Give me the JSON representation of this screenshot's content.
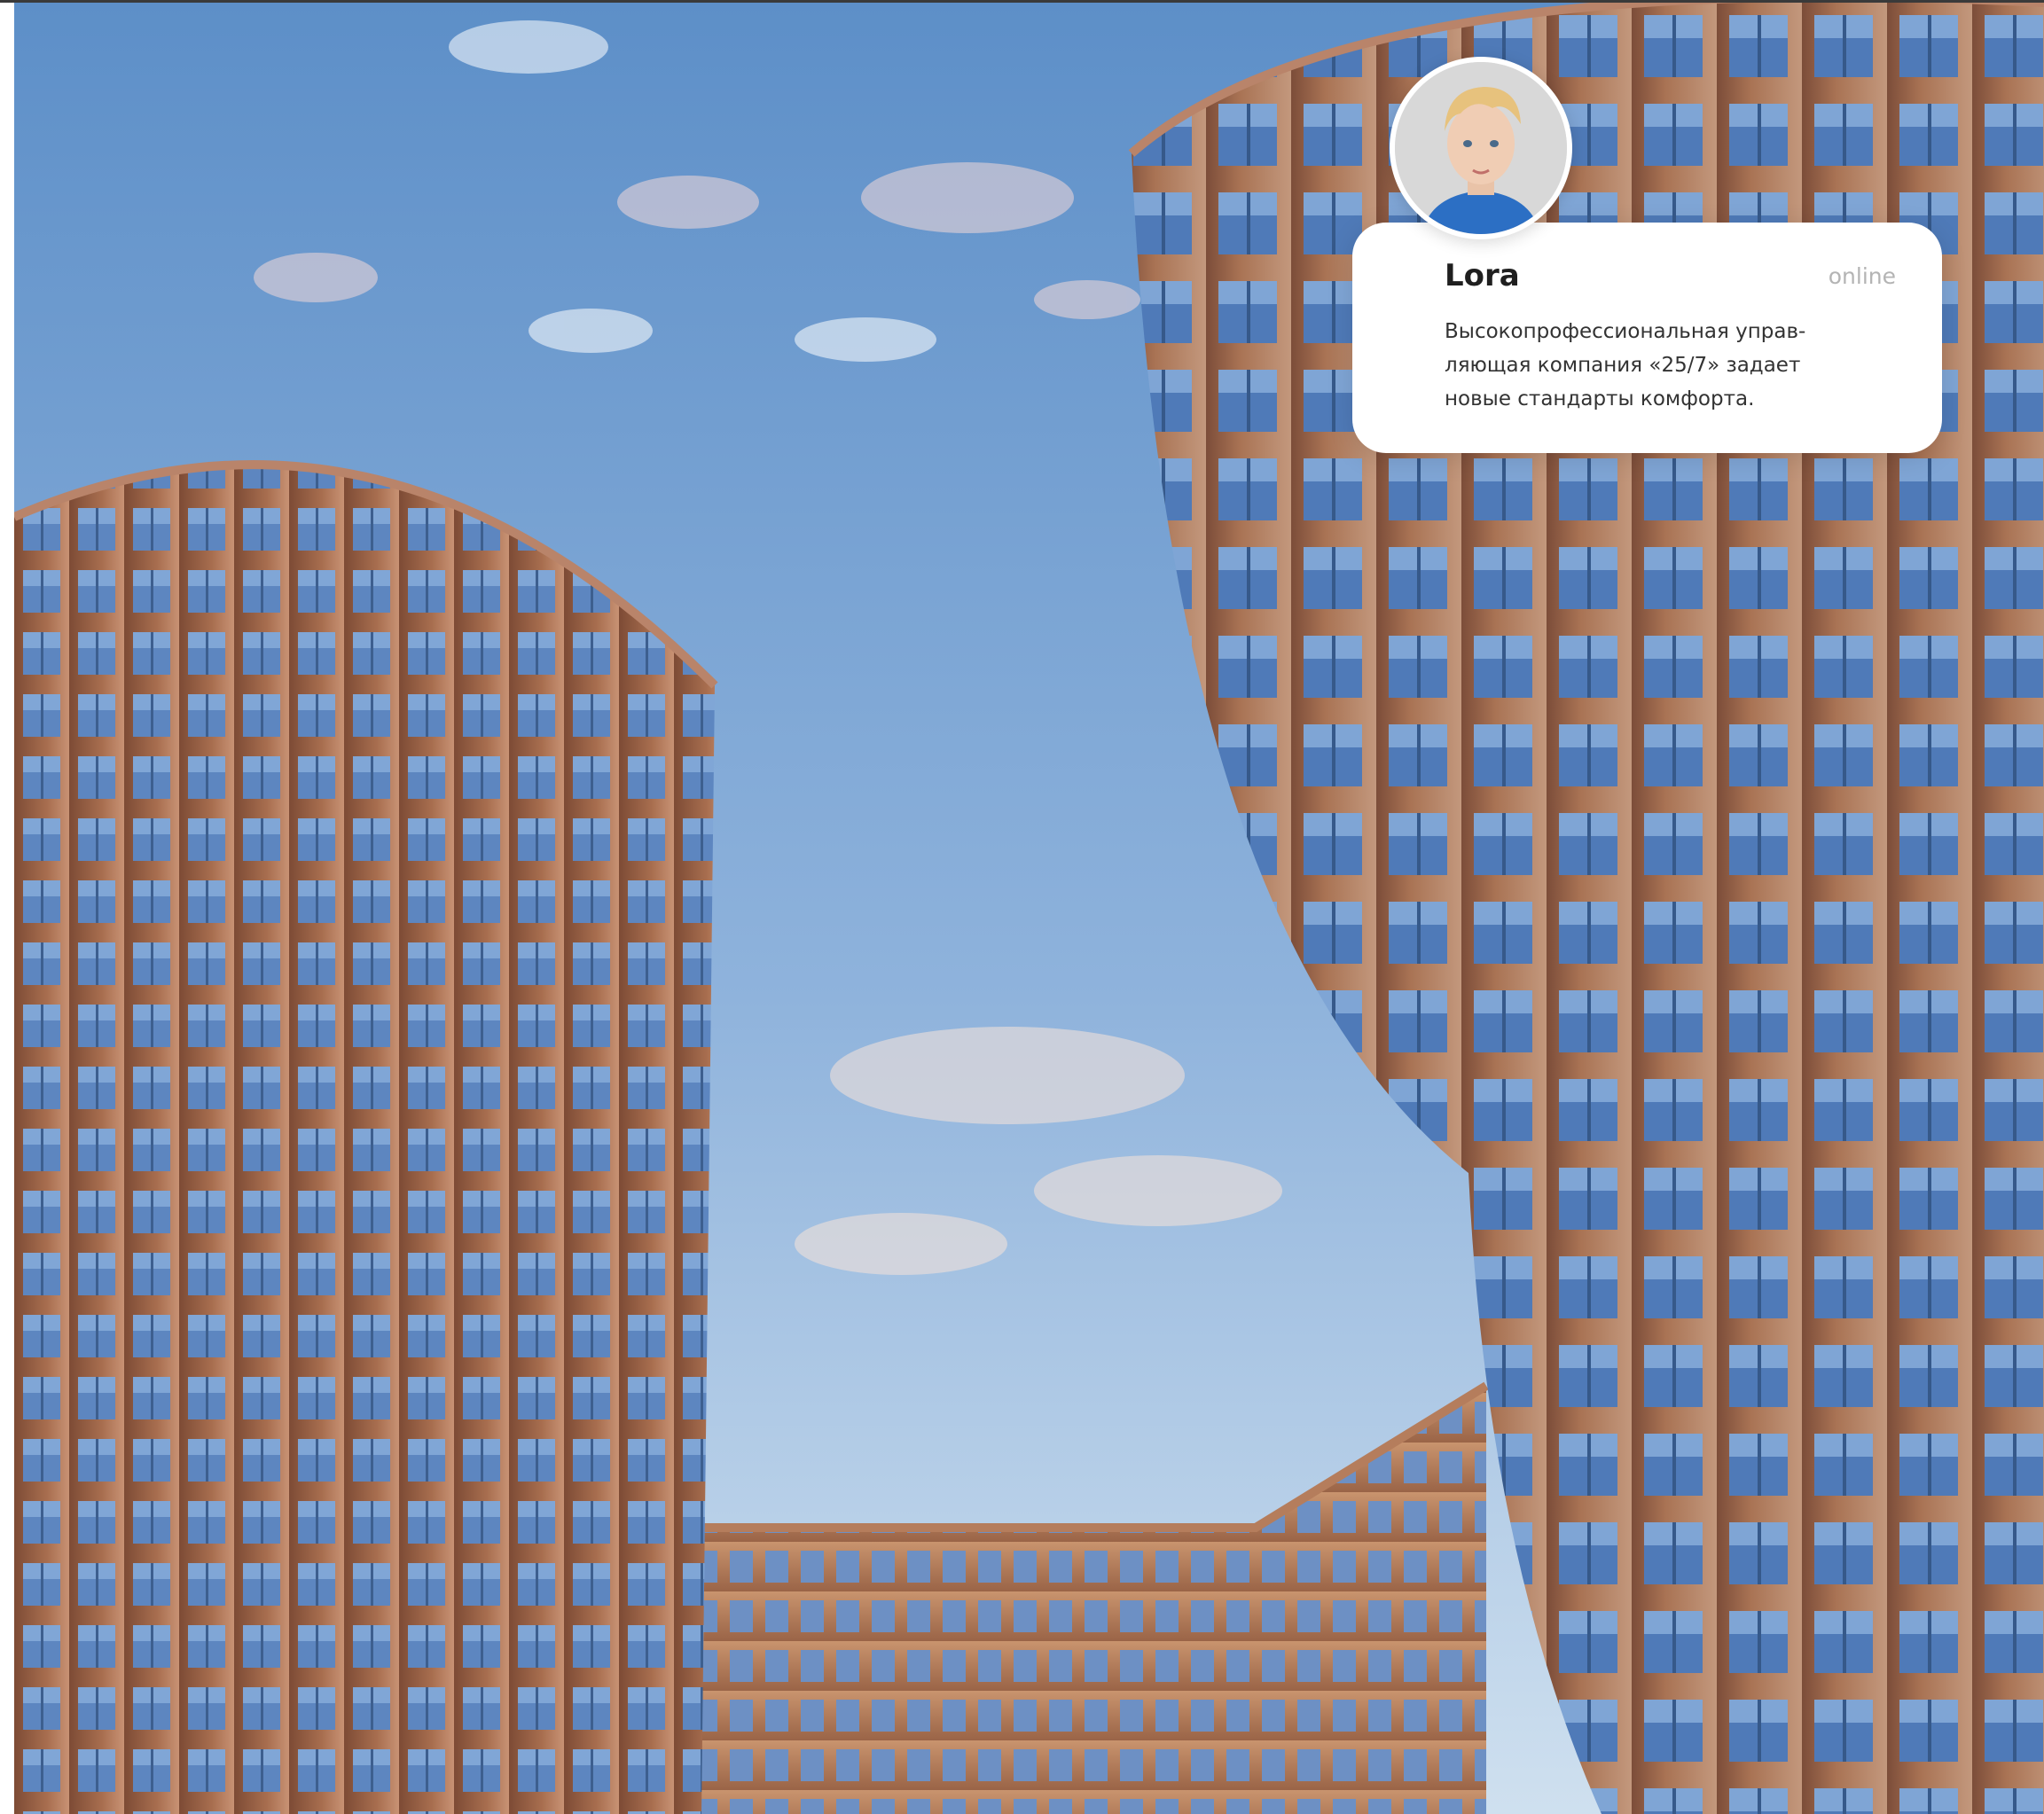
{
  "hero": {
    "image": "residential-towers-photo"
  },
  "chat_card": {
    "avatar": "assistant-avatar",
    "name": "Lora",
    "status": "online",
    "message": "Высокопрофессиональная управ-\nляющая компания «25/7» задает\nновые стандарты комфорта."
  },
  "colors": {
    "card_background": "#ffffff",
    "status_text": "#b4b4b4",
    "name_text": "#1f1f1f",
    "sky_top": "#5d8fc8",
    "sky_bottom": "#cfe0ef",
    "facade": "#a86e4f",
    "window": "#5d86c0"
  }
}
